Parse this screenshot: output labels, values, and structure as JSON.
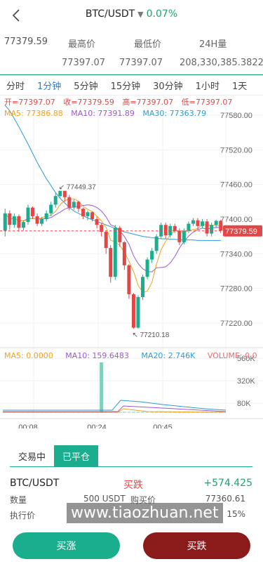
{
  "header": {
    "pair": "BTC/USDT",
    "dropdown_icon": "caret-down-icon",
    "change_pct": "0.07%"
  },
  "stats": {
    "last_price": "77379.59",
    "high_label": "最高价",
    "low_label": "最低价",
    "vol_label": "24H量",
    "high_value": "77397.07",
    "low_value": "77397.07",
    "vol_value": "208,330,385.3822"
  },
  "periods": [
    "分时",
    "1分钟",
    "5分钟",
    "15分钟",
    "30分钟",
    "1小时",
    "1天"
  ],
  "active_period": "1分钟",
  "ohlc": {
    "open": "开=77397.07",
    "close": "收=77379.59",
    "high": "高=77397.07",
    "low": "低=77397.07"
  },
  "ma": {
    "ma5": "MA5: 77386.88",
    "ma10": "MA10: 77391.89",
    "ma30": "MA30: 77363.79"
  },
  "vol_ma": {
    "ma5": "MA5: 0.0000",
    "ma10": "MA10: 159.6483",
    "ma20": "MA20: 2.746K",
    "volume": "VOLUME: 0.0"
  },
  "colors": {
    "up": "#1aae8f",
    "down": "#e04848",
    "ma5": "#f0a020",
    "ma10": "#9b59d0",
    "ma30": "#2a9ad8",
    "ohlc_text": "#e04848",
    "last_price_tag": "#e04848"
  },
  "chart_data": {
    "type": "candlestick",
    "y_ticks": [
      "77580.00",
      "77520.00",
      "77460.00",
      "77400.00",
      "77340.00",
      "77280.00",
      "77220.00"
    ],
    "y_values": [
      77580,
      77520,
      77460,
      77400,
      77340,
      77280,
      77220
    ],
    "x_ticks": [
      "00:08",
      "00:24",
      "00:45"
    ],
    "volume_ticks": [
      "560K",
      "320K",
      "80K"
    ],
    "high_label": "77449.37",
    "low_label": "77210.18",
    "last_price_tag": "77379.59",
    "candles": [
      [
        77380,
        77410,
        77370,
        77418
      ],
      [
        77410,
        77390,
        77382,
        77415
      ],
      [
        77390,
        77405,
        77385,
        77410
      ],
      [
        77405,
        77385,
        77378,
        77408
      ],
      [
        77385,
        77395,
        77380,
        77398
      ],
      [
        77395,
        77420,
        77390,
        77425
      ],
      [
        77420,
        77405,
        77400,
        77422
      ],
      [
        77405,
        77392,
        77388,
        77410
      ],
      [
        77392,
        77400,
        77388,
        77404
      ],
      [
        77400,
        77410,
        77396,
        77415
      ],
      [
        77410,
        77425,
        77405,
        77430
      ],
      [
        77425,
        77440,
        77420,
        77445
      ],
      [
        77440,
        77449,
        77436,
        77449
      ],
      [
        77449,
        77438,
        77430,
        77449
      ],
      [
        77438,
        77420,
        77415,
        77442
      ],
      [
        77420,
        77430,
        77416,
        77434
      ],
      [
        77430,
        77418,
        77412,
        77432
      ],
      [
        77418,
        77405,
        77400,
        77420
      ],
      [
        77405,
        77412,
        77398,
        77415
      ],
      [
        77412,
        77400,
        77396,
        77414
      ],
      [
        77400,
        77390,
        77384,
        77404
      ],
      [
        77390,
        77378,
        77370,
        77393
      ],
      [
        77378,
        77350,
        77340,
        77380
      ],
      [
        77350,
        77300,
        77290,
        77355
      ],
      [
        77300,
        77385,
        77295,
        77390
      ],
      [
        77385,
        77360,
        77352,
        77388
      ],
      [
        77360,
        77320,
        77312,
        77362
      ],
      [
        77320,
        77270,
        77262,
        77322
      ],
      [
        77270,
        77212,
        77210,
        77272
      ],
      [
        77212,
        77265,
        77210,
        77268
      ],
      [
        77265,
        77300,
        77260,
        77304
      ],
      [
        77300,
        77330,
        77296,
        77334
      ],
      [
        77330,
        77345,
        77324,
        77350
      ],
      [
        77345,
        77370,
        77340,
        77374
      ],
      [
        77370,
        77390,
        77366,
        77394
      ],
      [
        77390,
        77372,
        77366,
        77394
      ],
      [
        77372,
        77388,
        77368,
        77392
      ],
      [
        77388,
        77380,
        77376,
        77392
      ],
      [
        77380,
        77360,
        77355,
        77384
      ],
      [
        77360,
        77380,
        77356,
        77384
      ],
      [
        77380,
        77392,
        77376,
        77396
      ],
      [
        77392,
        77398,
        77388,
        77402
      ],
      [
        77398,
        77388,
        77382,
        77402
      ],
      [
        77388,
        77396,
        77384,
        77400
      ],
      [
        77396,
        77375,
        77370,
        77400
      ],
      [
        77375,
        77390,
        77370,
        77394
      ],
      [
        77390,
        77397,
        77386,
        77399
      ],
      [
        77397,
        77380,
        77376,
        77399
      ]
    ],
    "ma30_line": [
      77600,
      77588,
      77574,
      77560,
      77545,
      77530,
      77514,
      77498,
      77484,
      77470,
      77458,
      77446,
      77436,
      77428,
      77420,
      77414,
      77410,
      77406,
      77402,
      77399,
      77396,
      77393,
      77390,
      77387,
      77384,
      77381,
      77378,
      77376,
      77374,
      77372,
      77370,
      77369,
      77368,
      77367,
      77366,
      77366,
      77365,
      77365,
      77364,
      77364,
      77364,
      77364,
      77363,
      77363,
      77363,
      77363,
      77363,
      77363
    ]
  },
  "trade": {
    "tabs": [
      "交易中",
      "已平仓"
    ],
    "active_tab": "已平仓",
    "row_pair": "BTC/USDT",
    "row_side": "买跌",
    "row_profit": "+574.425",
    "qty_label": "数量",
    "qty_value": "500 USDT",
    "buy_label": "购买价",
    "buy_value": "77360.61",
    "exec_label": "执行价",
    "exec_pct": "15%",
    "buy_up": "买涨",
    "buy_down": "买跌"
  },
  "watermark": "www.tiaozhuan.net"
}
